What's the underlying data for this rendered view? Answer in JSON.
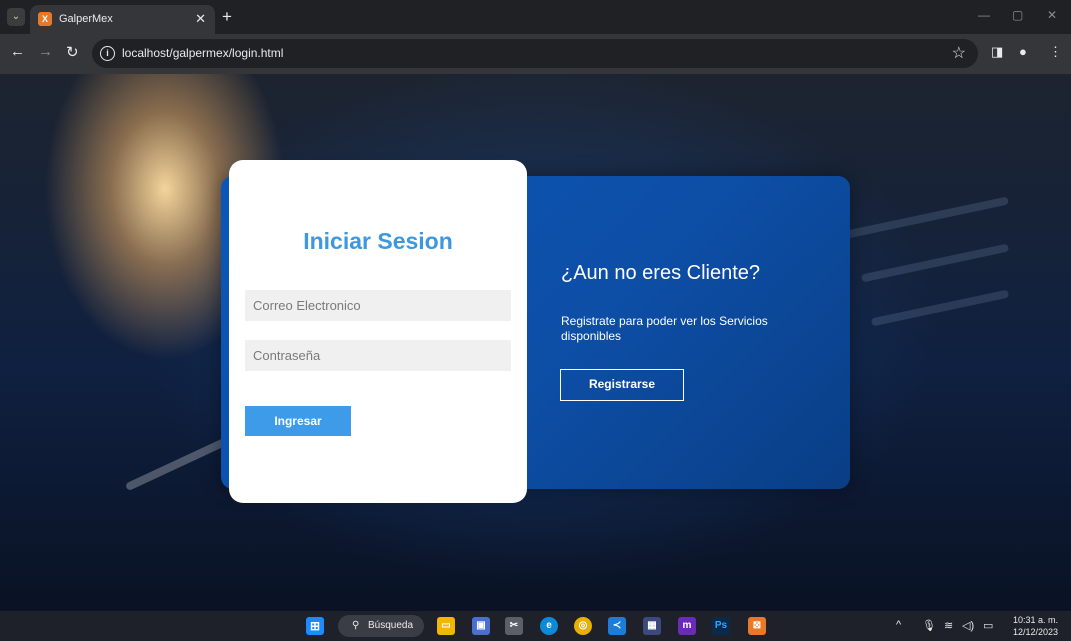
{
  "browser": {
    "tab_title": "GalperMex",
    "tab_favicon": "X",
    "url": "localhost/galpermex/login.html"
  },
  "login": {
    "title": "Iniciar Sesion",
    "email_placeholder": "Correo Electronico",
    "password_placeholder": "Contraseña",
    "submit_label": "Ingresar"
  },
  "register": {
    "title": "¿Aun no eres Cliente?",
    "text": "Registrate para poder ver los Servicios disponibles",
    "button_label": "Registrarse"
  },
  "taskbar": {
    "search_label": "Búsqueda",
    "time": "10:31 a. m.",
    "date": "12/12/2023"
  }
}
